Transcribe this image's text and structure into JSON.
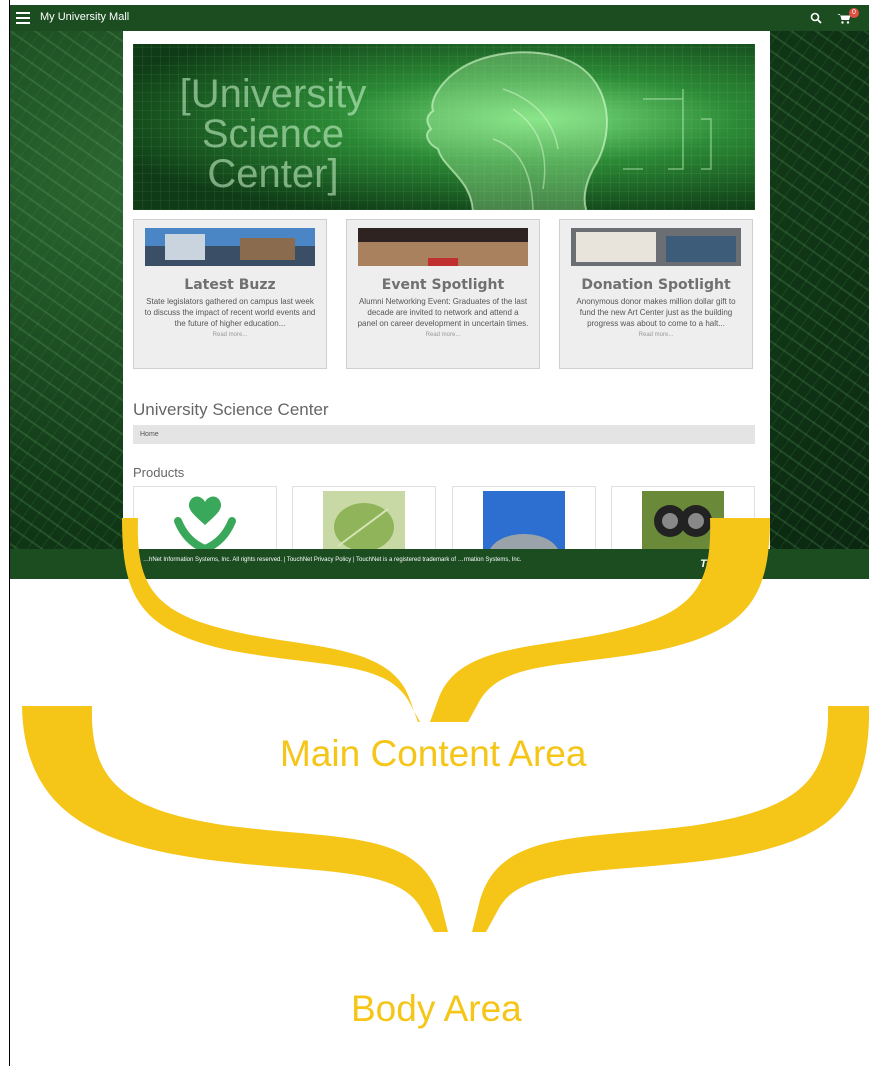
{
  "header": {
    "site_title": "My University Mall",
    "cart_count": "0"
  },
  "hero": {
    "title_line1": "[University",
    "title_line2": "Science",
    "title_line3": "Center]"
  },
  "cards": [
    {
      "title": "Latest Buzz",
      "text": "State legislators gathered on campus last week to discuss the impact of recent world events and the future of higher education...",
      "more": "Read more..."
    },
    {
      "title": "Event Spotlight",
      "text": "Alumni Networking Event: Graduates of the last decade are invited to network and attend a panel on career development in uncertain times.",
      "more": "Read more..."
    },
    {
      "title": "Donation Spotlight",
      "text": "Anonymous donor makes million dollar gift to fund the new Art Center just as the building progress was about to come to a halt...",
      "more": "Read more..."
    }
  ],
  "section_title": "University Science Center",
  "breadcrumb": "Home",
  "products_label": "Products",
  "products": [
    {
      "icon": "heart-hands-icon"
    },
    {
      "icon": "leaf-image"
    },
    {
      "icon": "dome-building-image"
    },
    {
      "icon": "binoculars-image"
    }
  ],
  "footer": {
    "text": "…hNet Information Systems, Inc. All rights reserved. | TouchNet Privacy Policy | TouchNet is a registered trademark of …rmation Systems, Inc.",
    "logo": "To"
  },
  "annotations": {
    "main_content": "Main Content Area",
    "body": "Body Area"
  },
  "colors": {
    "header_green": "#1b4d21",
    "annotation_yellow": "#f5c518"
  }
}
